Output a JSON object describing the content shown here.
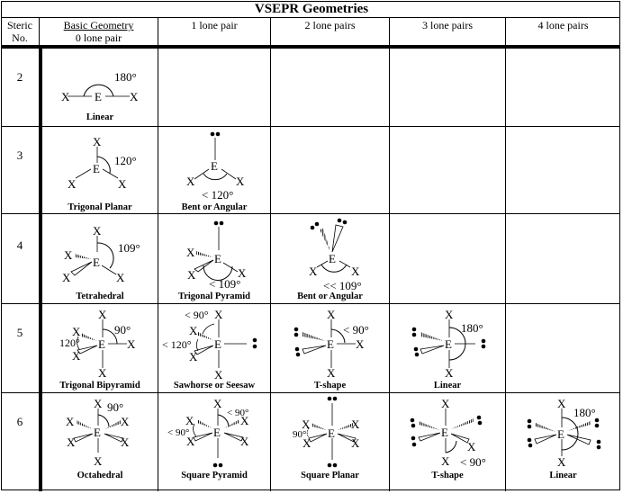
{
  "title": "VSEPR Geometries",
  "headers": {
    "steric_line1": "Steric",
    "steric_line2": "No.",
    "basic_line1": "Basic Geometry",
    "basic_line2": "0 lone pair",
    "lp1": "1 lone pair",
    "lp2": "2 lone pairs",
    "lp3": "3 lone pairs",
    "lp4": "4 lone pairs"
  },
  "rows": [
    {
      "steric": "2",
      "cells": [
        {
          "name": "Linear",
          "angle": "180°"
        }
      ]
    },
    {
      "steric": "3",
      "cells": [
        {
          "name": "Trigonal Planar",
          "angle": "120°"
        },
        {
          "name": "Bent or Angular",
          "angle": "< 120°"
        }
      ]
    },
    {
      "steric": "4",
      "cells": [
        {
          "name": "Tetrahedral",
          "angle": "109°"
        },
        {
          "name": "Trigonal Pyramid",
          "angle": "< 109°"
        },
        {
          "name": "Bent or Angular",
          "angle": "<< 109°"
        }
      ]
    },
    {
      "steric": "5",
      "cells": [
        {
          "name": "Trigonal Bipyramid",
          "angle": "90°",
          "angle2": "120°"
        },
        {
          "name": "Sawhorse or Seesaw",
          "angle": "< 90°",
          "angle2": "< 120°"
        },
        {
          "name": "T-shape",
          "angle": "< 90°"
        },
        {
          "name": "Linear",
          "angle": "180°"
        }
      ]
    },
    {
      "steric": "6",
      "cells": [
        {
          "name": "Octahedral",
          "angle": "90°"
        },
        {
          "name": "Square Pyramid",
          "angle": "< 90°",
          "angle2": "< 90°"
        },
        {
          "name": "Square Planar",
          "angle": "90°"
        },
        {
          "name": "T-shape",
          "angle": "< 90°"
        },
        {
          "name": "Linear",
          "angle": "180°"
        }
      ]
    }
  ],
  "symbols": {
    "central": "E",
    "ligand": "X"
  }
}
